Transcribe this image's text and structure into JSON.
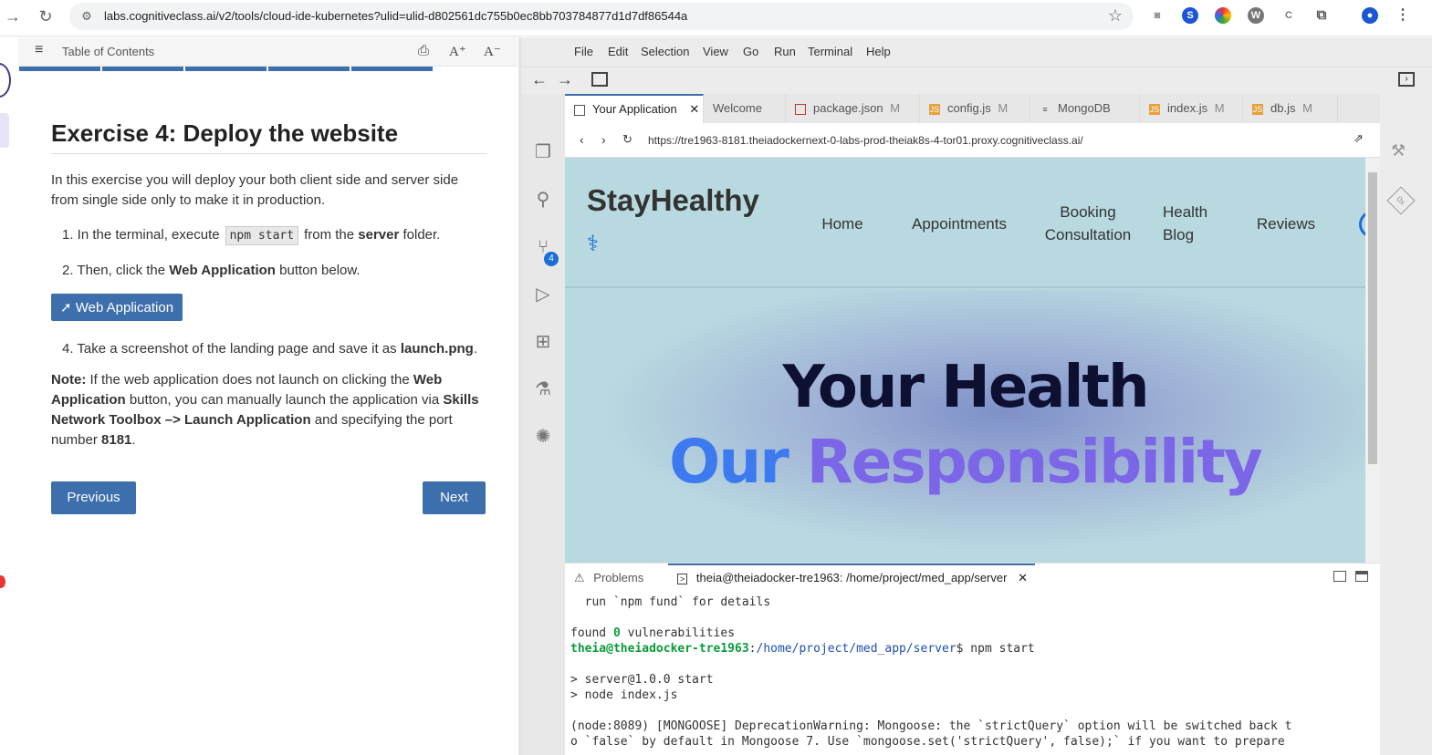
{
  "browser": {
    "url": "labs.cognitiveclass.ai/v2/tools/cloud-ide-kubernetes?ulid=ulid-d802561dc755b0ec8bb703784877d1d7df86544a"
  },
  "toc": {
    "label": "Table of Contents",
    "font_increase": "A⁺",
    "font_decrease": "A⁻"
  },
  "lesson": {
    "title": "Exercise 4: Deploy the website",
    "intro": "In this exercise you will deploy your both client side and server side from single side only to make it in production.",
    "step1_pre": "1. In the terminal, execute",
    "step1_code": "npm start",
    "step1_mid": "from the",
    "step1_bold": "server",
    "step1_post": "folder.",
    "step2_pre": "2. Then, click the",
    "step2_bold": "Web Application",
    "step2_post": "button below.",
    "web_app_button": "Web Application",
    "step4_pre": "4. Take a screenshot of the landing page and save it as",
    "step4_bold": "launch.png",
    "step4_post": ".",
    "note_label": "Note:",
    "note_1": "If the web application does not launch on clicking the",
    "note_b1": "Web Application",
    "note_2": "button, you can manually launch the application via",
    "note_b2": "Skills Network Toolbox –> Launch Application",
    "note_3": "and specifying the port number",
    "note_b3": "8181",
    "note_4": ".",
    "previous": "Previous",
    "next": "Next"
  },
  "ide": {
    "menus": [
      "File",
      "Edit",
      "Selection",
      "View",
      "Go",
      "Run",
      "Terminal",
      "Help"
    ],
    "tabs": [
      {
        "label": "Your Application",
        "suffix": ""
      },
      {
        "label": "Welcome",
        "suffix": ""
      },
      {
        "label": "package.json",
        "suffix": "M"
      },
      {
        "label": "config.js",
        "suffix": "M"
      },
      {
        "label": "MongoDB",
        "suffix": ""
      },
      {
        "label": "index.js",
        "suffix": "M"
      },
      {
        "label": "db.js",
        "suffix": "M"
      }
    ],
    "scm_badge": "4",
    "app_url": "https://tre1963-8181.theiadockernext-0-labs-prod-theiak8s-4-tor01.proxy.cognitiveclass.ai/",
    "site": {
      "logo": "StayHealthy",
      "nav": [
        "Home",
        "Appointments",
        "Booking Consultation",
        "Health Blog",
        "Reviews"
      ],
      "hero_line1": "Your Health",
      "hero_line2a": "Our ",
      "hero_line2b": "Responsibility"
    },
    "panel": {
      "problems": "Problems",
      "terminal_tab": "theia@theiadocker-tre1963: /home/project/med_app/server"
    },
    "terminal": {
      "line1": "  run `npm fund` for details",
      "line2a": "found ",
      "line2b": "0",
      "line2c": " vulnerabilities",
      "prompt_user": "theia@theiadocker-tre1963",
      "prompt_path": "/home/project/med_app/server",
      "prompt_cmd": "$ npm start",
      "line4": "> server@1.0.0 start",
      "line5": "> node index.js",
      "line6": "(node:8089) [MONGOOSE] DeprecationWarning: Mongoose: the `strictQuery` option will be switched back t",
      "line7": "o `false` by default in Mongoose 7. Use `mongoose.set('strictQuery', false);` if you want to prepare"
    }
  },
  "colors": {
    "accent": "#3d6fad",
    "hero_blue": "#3d7af0",
    "hero_purple": "#7c66e8"
  }
}
